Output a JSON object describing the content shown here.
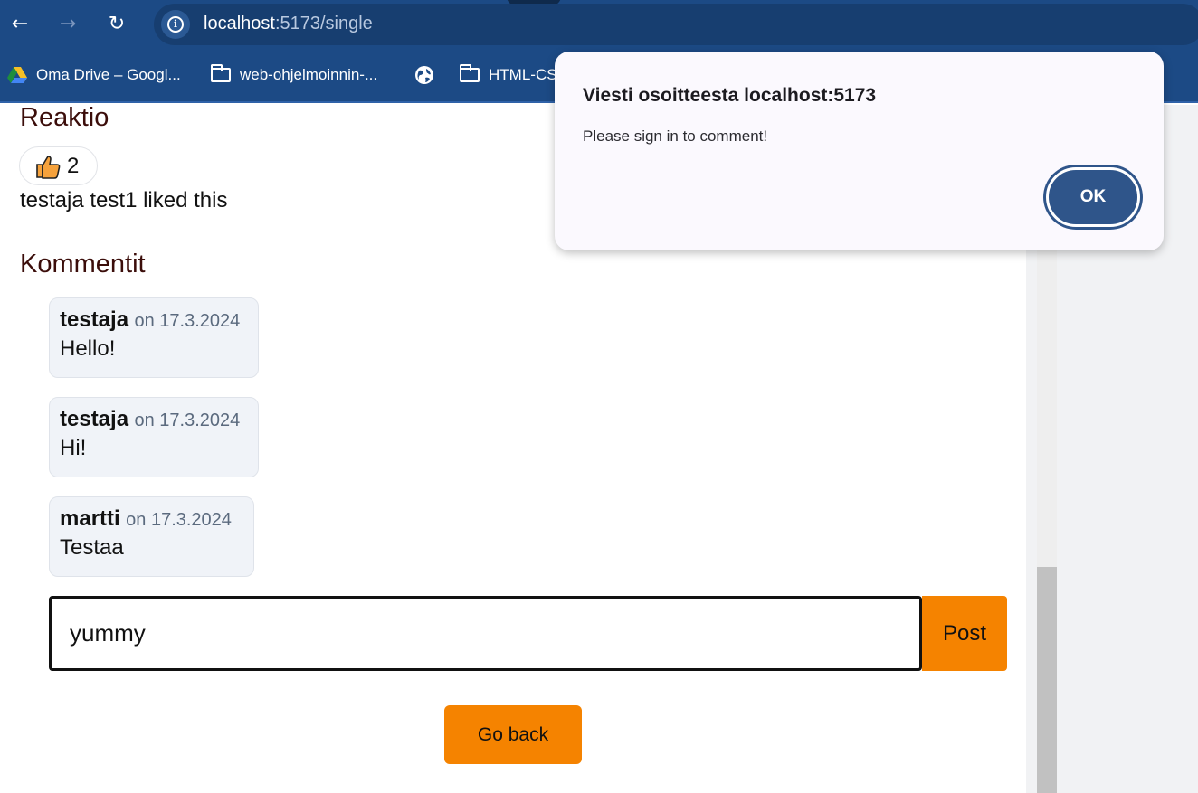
{
  "browser": {
    "url_host": "localhost",
    "url_path": ":5173/single",
    "bookmarks": [
      {
        "label": "Oma Drive – Googl...",
        "icon": "google-drive-icon"
      },
      {
        "label": "web-ohjelmoinnin-...",
        "icon": "folder-icon"
      },
      {
        "label": "",
        "icon": "globe-icon"
      },
      {
        "label": "HTML-CS",
        "icon": "folder-icon"
      }
    ]
  },
  "reactions": {
    "heading": "Reaktio",
    "count": "2",
    "liked_text": "testaja test1 liked this"
  },
  "comments": {
    "heading": "Kommentit",
    "items": [
      {
        "author": "testaja",
        "date": "on 17.3.2024",
        "text": "Hello!"
      },
      {
        "author": "testaja",
        "date": "on 17.3.2024",
        "text": "Hi!"
      },
      {
        "author": "martti",
        "date": "on 17.3.2024",
        "text": "Testaa"
      }
    ],
    "input_value": "yummy",
    "post_label": "Post"
  },
  "go_back_label": "Go back",
  "dialog": {
    "title": "Viesti osoitteesta localhost:5173",
    "message": "Please sign in to comment!",
    "ok_label": "OK"
  },
  "colors": {
    "accent_orange": "#f58300",
    "heading_color": "#3b0d0a",
    "browser_blue": "#1c4a85",
    "dialog_button": "#2f558a"
  }
}
